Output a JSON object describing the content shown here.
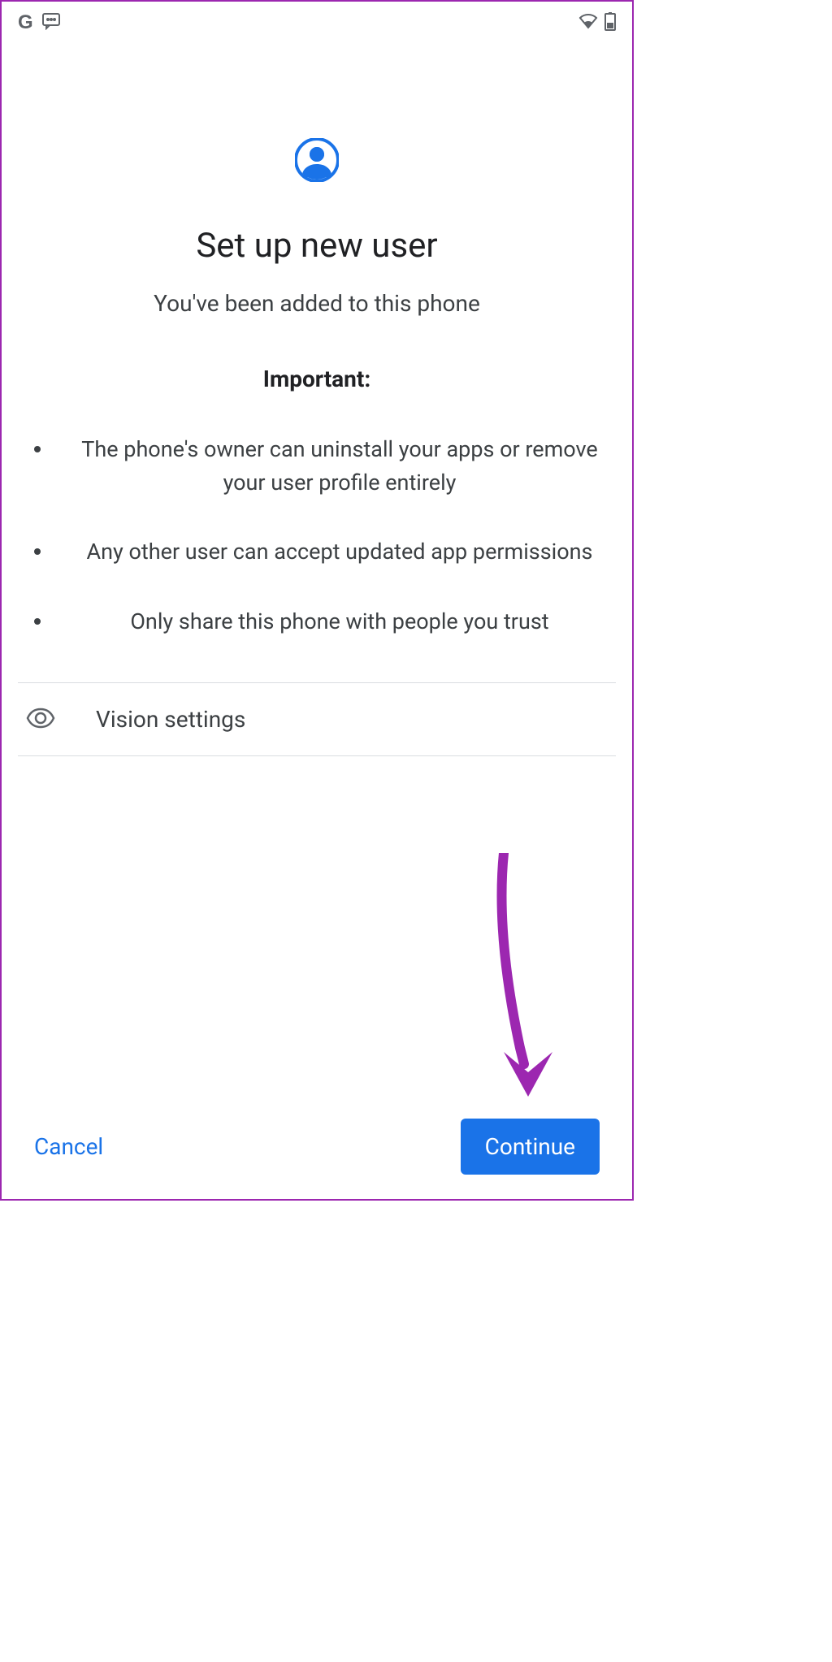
{
  "statusBar": {
    "icons": {
      "google": "G",
      "message": "message-icon",
      "wifi": "wifi-icon",
      "battery": "battery-icon"
    }
  },
  "header": {
    "iconName": "profile-icon",
    "title": "Set up new user",
    "subtitle": "You've been added to this phone"
  },
  "important": {
    "label": "Important:",
    "bullets": [
      "The phone's owner can uninstall your apps or remove your user profile entirely",
      "Any other user can accept updated app permissions",
      "Only share this phone with people you trust"
    ]
  },
  "visionSettings": {
    "label": "Vision settings"
  },
  "footer": {
    "cancelLabel": "Cancel",
    "continueLabel": "Continue"
  },
  "colors": {
    "accent": "#1a73e8",
    "annotation": "#9c27b0"
  }
}
